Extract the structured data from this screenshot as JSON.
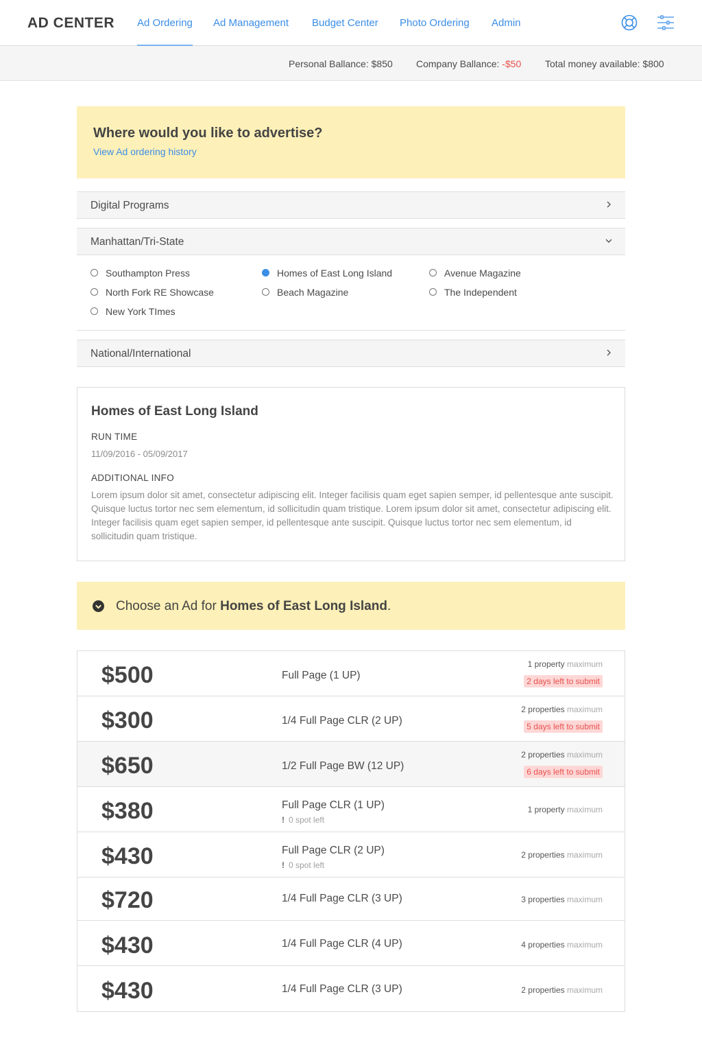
{
  "app": {
    "title": "AD CENTER"
  },
  "nav": {
    "links": [
      "Ad Ordering",
      "Ad Management",
      "Budget Center",
      "Photo Ordering",
      "Admin"
    ],
    "active": "Ad Ordering",
    "icons": [
      "lifebuoy-icon",
      "sliders-icon"
    ]
  },
  "balances": {
    "personal_label": "Personal Ballance:",
    "personal_value": "$850",
    "company_label": "Company Ballance:",
    "company_value": "-$50",
    "total_label": "Total money available:",
    "total_value": "$800"
  },
  "advertise": {
    "title": "Where would you like to advertise?",
    "history_link": "View Ad ordering history"
  },
  "categories": [
    {
      "label": "Digital Programs",
      "expanded": false
    },
    {
      "label": "Manhattan/Tri-State",
      "expanded": true
    },
    {
      "label": "National/International",
      "expanded": false
    }
  ],
  "publications": [
    {
      "label": "Southampton Press",
      "selected": false
    },
    {
      "label": "Homes of East Long Island",
      "selected": true
    },
    {
      "label": "Avenue Magazine",
      "selected": false
    },
    {
      "label": "North Fork RE Showcase",
      "selected": false
    },
    {
      "label": "Beach Magazine",
      "selected": false
    },
    {
      "label": "The Independent",
      "selected": false
    },
    {
      "label": "New York TImes",
      "selected": false
    }
  ],
  "details": {
    "title": "Homes of East Long Island",
    "run_time_label": "RUN TIME",
    "run_time_value": "11/09/2016 - 05/09/2017",
    "info_label": "ADDITIONAL INFO",
    "info_text": "Lorem ipsum dolor sit amet, consectetur adipiscing elit. Integer facilisis quam eget sapien semper, id pellentesque ante suscipit. Quisque luctus tortor nec sem elementum, id sollicitudin quam tristique. Lorem ipsum dolor sit amet, consectetur adipiscing elit. Integer facilisis quam eget sapien semper, id pellentesque ante suscipit. Quisque luctus tortor nec sem elementum, id sollicitudin quam tristique."
  },
  "choose": {
    "prefix": "Choose an Ad for",
    "publication": "Homes of East Long Island",
    "suffix": "."
  },
  "ads": [
    {
      "price": "$500",
      "name": "Full Page (1 UP)",
      "props_count": "1 property",
      "props_suffix": "maximum",
      "deadline": "2 days left to submit",
      "spot": "",
      "highlight": false
    },
    {
      "price": "$300",
      "name": "1/4 Full Page CLR (2 UP)",
      "props_count": "2 properties",
      "props_suffix": "maximum",
      "deadline": "5 days left to submit",
      "spot": "",
      "highlight": false
    },
    {
      "price": "$650",
      "name": "1/2 Full Page BW (12 UP)",
      "props_count": "2 properties",
      "props_suffix": "maximum",
      "deadline": "6 days left to submit",
      "spot": "",
      "highlight": true
    },
    {
      "price": "$380",
      "name": "Full Page CLR (1 UP)",
      "props_count": "1 property",
      "props_suffix": "maximum",
      "deadline": "",
      "spot": "0 spot left",
      "highlight": false
    },
    {
      "price": "$430",
      "name": "Full Page CLR (2 UP)",
      "props_count": "2 properties",
      "props_suffix": "maximum",
      "deadline": "",
      "spot": "0 spot left",
      "highlight": false
    },
    {
      "price": "$720",
      "name": "1/4 Full Page CLR (3 UP)",
      "props_count": "3 properties",
      "props_suffix": "maximum",
      "deadline": "",
      "spot": "",
      "highlight": false
    },
    {
      "price": "$430",
      "name": "1/4 Full Page CLR (4 UP)",
      "props_count": "4 properties",
      "props_suffix": "maximum",
      "deadline": "",
      "spot": "",
      "highlight": false
    },
    {
      "price": "$430",
      "name": "1/4 Full Page CLR (3 UP)",
      "props_count": "2 properties",
      "props_suffix": "maximum",
      "deadline": "",
      "spot": "",
      "highlight": false
    }
  ],
  "colors": {
    "accent": "#3b8ee6",
    "banner": "#fdf0b8",
    "negative": "#e8504d"
  }
}
